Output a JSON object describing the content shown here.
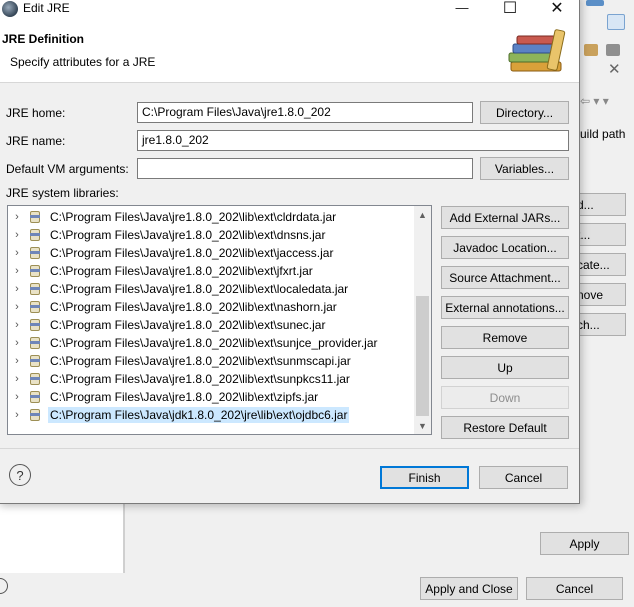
{
  "dialog": {
    "title": "Edit JRE",
    "header_title": "JRE Definition",
    "header_subtitle": "Specify attributes for a JRE",
    "minimize_glyph": "—",
    "maximize_glyph": "☐",
    "close_glyph": "✕"
  },
  "form": {
    "jre_home_label": "JRE home:",
    "jre_home_value": "C:\\Program Files\\Java\\jre1.8.0_202",
    "directory_button": "Directory...",
    "jre_name_label": "JRE name:",
    "jre_name_value": "jre1.8.0_202",
    "vm_args_label": "Default VM arguments:",
    "vm_args_value": "",
    "variables_button": "Variables...",
    "libraries_label": "JRE system libraries:"
  },
  "libraries": [
    "C:\\Program Files\\Java\\jre1.8.0_202\\lib\\ext\\cldrdata.jar",
    "C:\\Program Files\\Java\\jre1.8.0_202\\lib\\ext\\dnsns.jar",
    "C:\\Program Files\\Java\\jre1.8.0_202\\lib\\ext\\jaccess.jar",
    "C:\\Program Files\\Java\\jre1.8.0_202\\lib\\ext\\jfxrt.jar",
    "C:\\Program Files\\Java\\jre1.8.0_202\\lib\\ext\\localedata.jar",
    "C:\\Program Files\\Java\\jre1.8.0_202\\lib\\ext\\nashorn.jar",
    "C:\\Program Files\\Java\\jre1.8.0_202\\lib\\ext\\sunec.jar",
    "C:\\Program Files\\Java\\jre1.8.0_202\\lib\\ext\\sunjce_provider.jar",
    "C:\\Program Files\\Java\\jre1.8.0_202\\lib\\ext\\sunmscapi.jar",
    "C:\\Program Files\\Java\\jre1.8.0_202\\lib\\ext\\sunpkcs11.jar",
    "C:\\Program Files\\Java\\jre1.8.0_202\\lib\\ext\\zipfs.jar",
    "C:\\Program Files\\Java\\jdk1.8.0_202\\jre\\lib\\ext\\ojdbc6.jar"
  ],
  "selected_library_index": 11,
  "library_buttons": {
    "add_external": "Add External JARs...",
    "javadoc": "Javadoc Location...",
    "source": "Source Attachment...",
    "annotations": "External annotations...",
    "remove": "Remove",
    "up": "Up",
    "down": "Down",
    "restore": "Restore Default"
  },
  "footer": {
    "help_glyph": "?",
    "finish": "Finish",
    "cancel": "Cancel"
  },
  "background": {
    "side_text": "uild path",
    "btn1": "d...",
    "btn2": "t...",
    "btn3": "cate...",
    "btn4": "nove",
    "btn5": "ch...",
    "apply": "Apply",
    "apply_and_close": "Apply and Close",
    "cancel": "Cancel",
    "close_glyph": "✕"
  },
  "colors": {
    "selection": "#cce8ff",
    "default_button_border": "#0078d7"
  }
}
